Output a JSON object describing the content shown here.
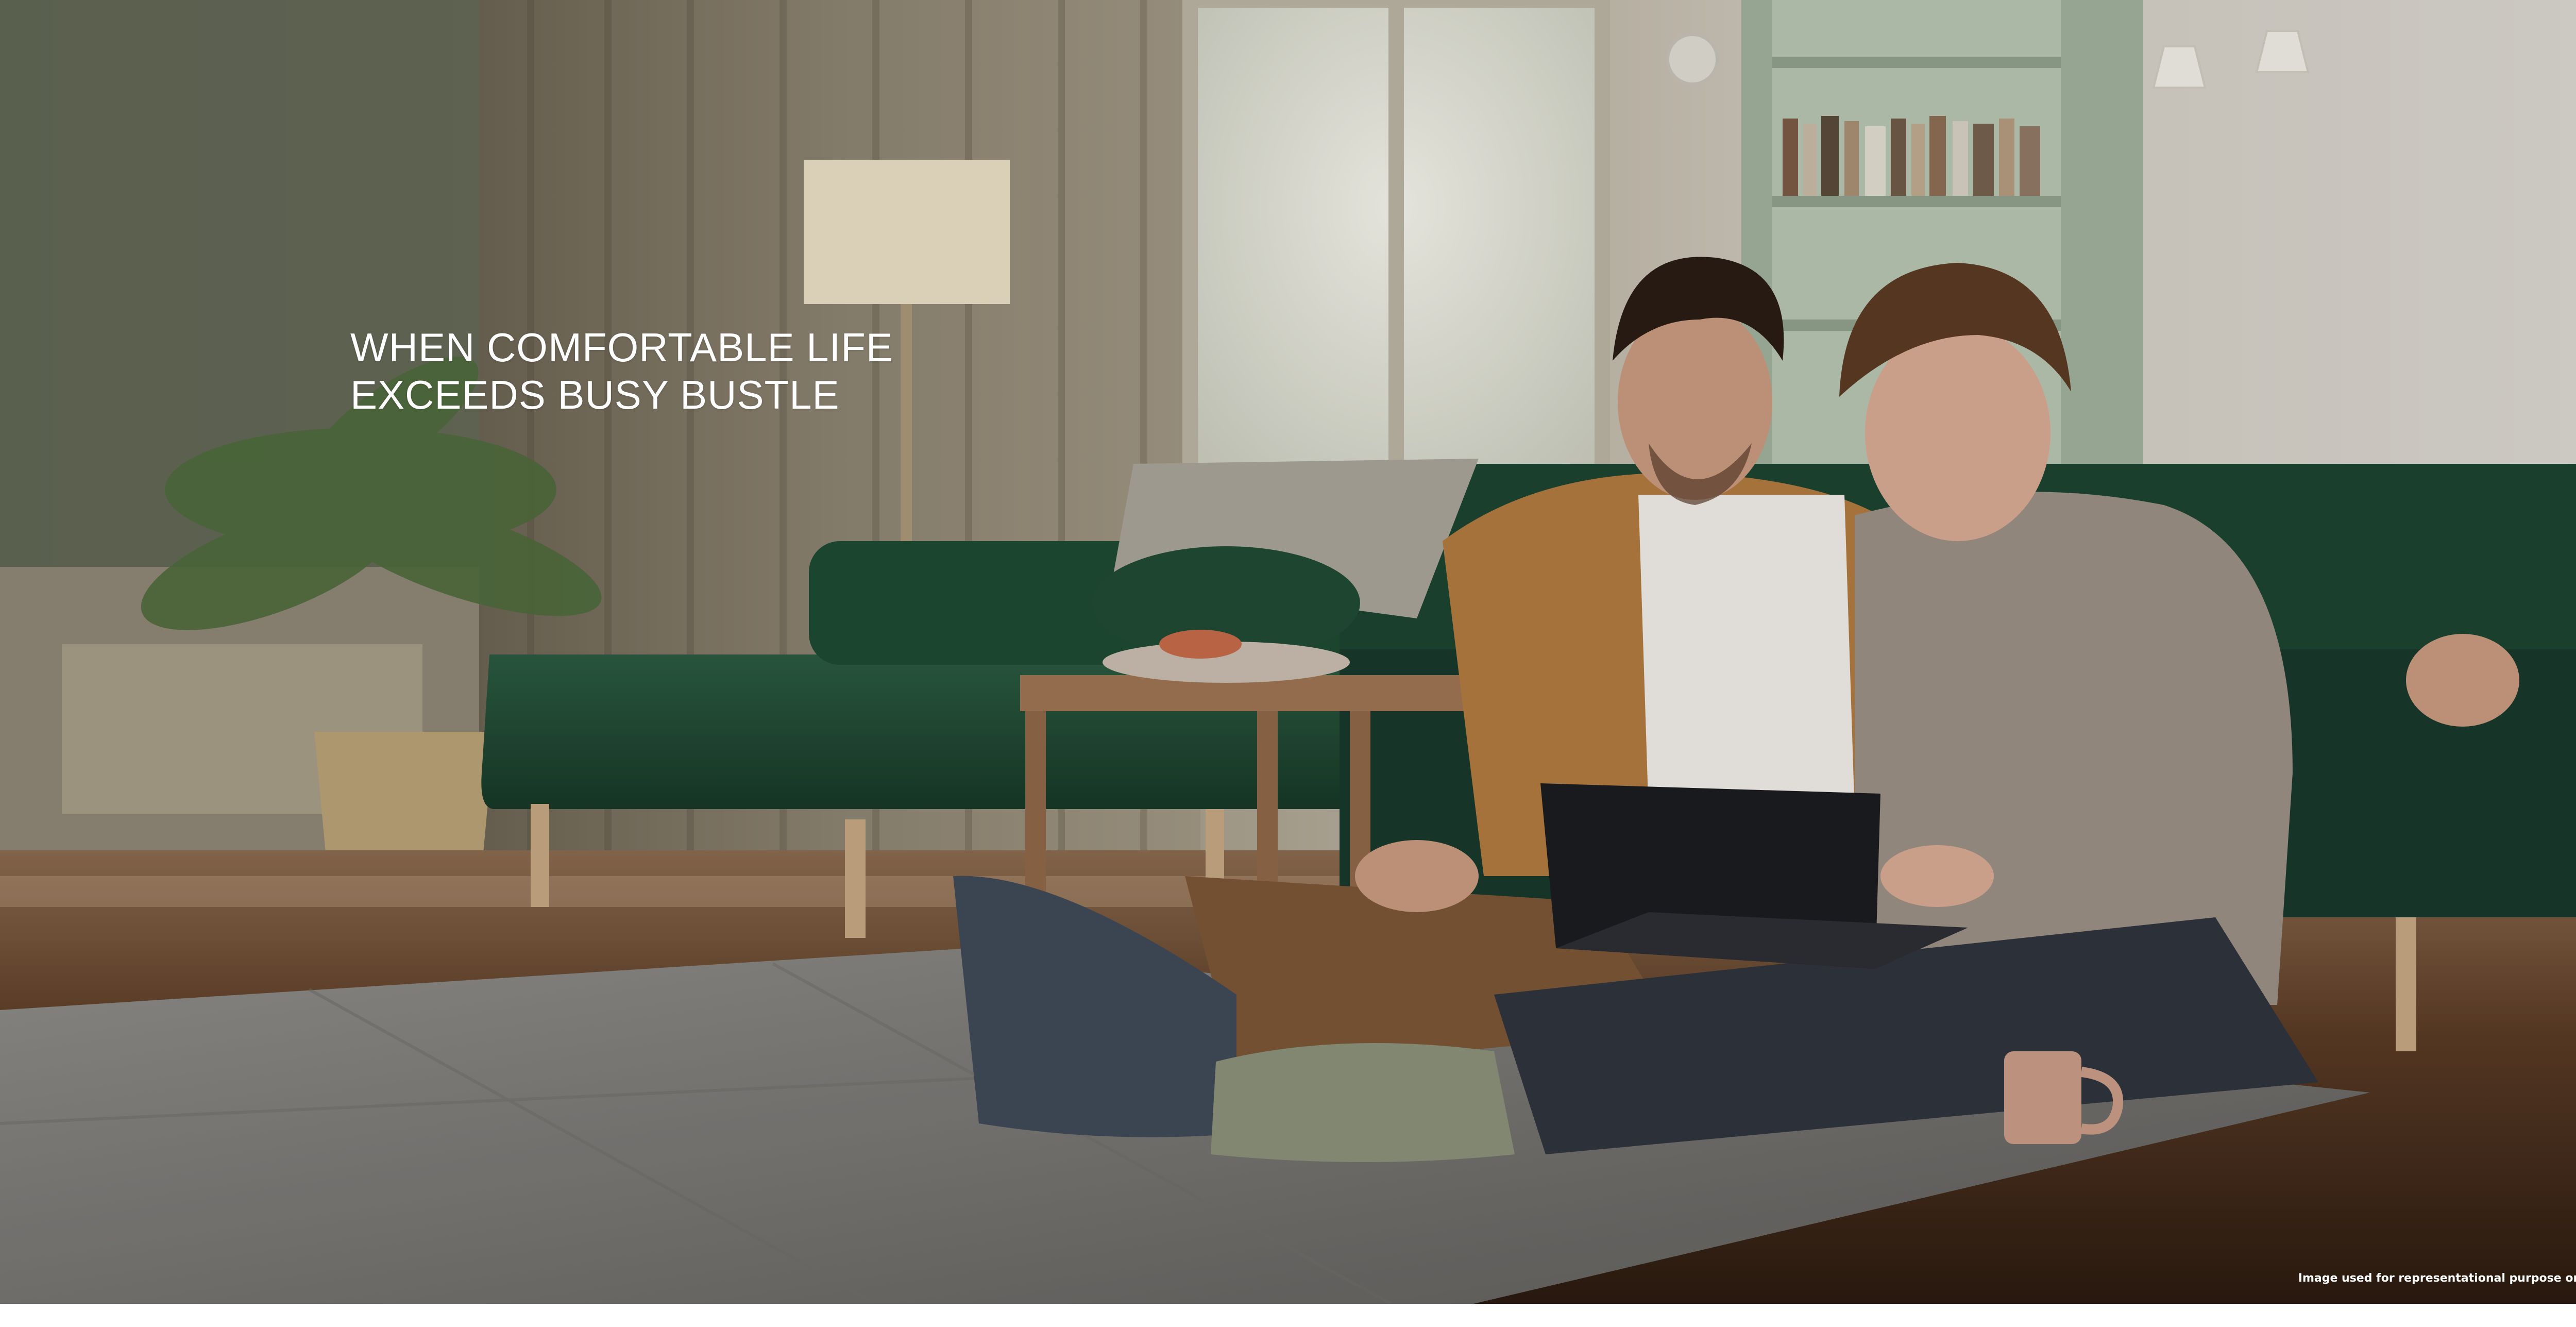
{
  "hero": {
    "headline_line1": "WHEN COMFORTABLE LIFE",
    "headline_line2": "EXCEEDS BUSY BUSTLE",
    "disclaimer": "Image used for representational purpose only"
  },
  "colors": {
    "sofa": "#1f4a33",
    "wall": "#b5b0a6",
    "floor": "#3c2819",
    "rug": "#7d7b77",
    "text": "#ffffff"
  }
}
